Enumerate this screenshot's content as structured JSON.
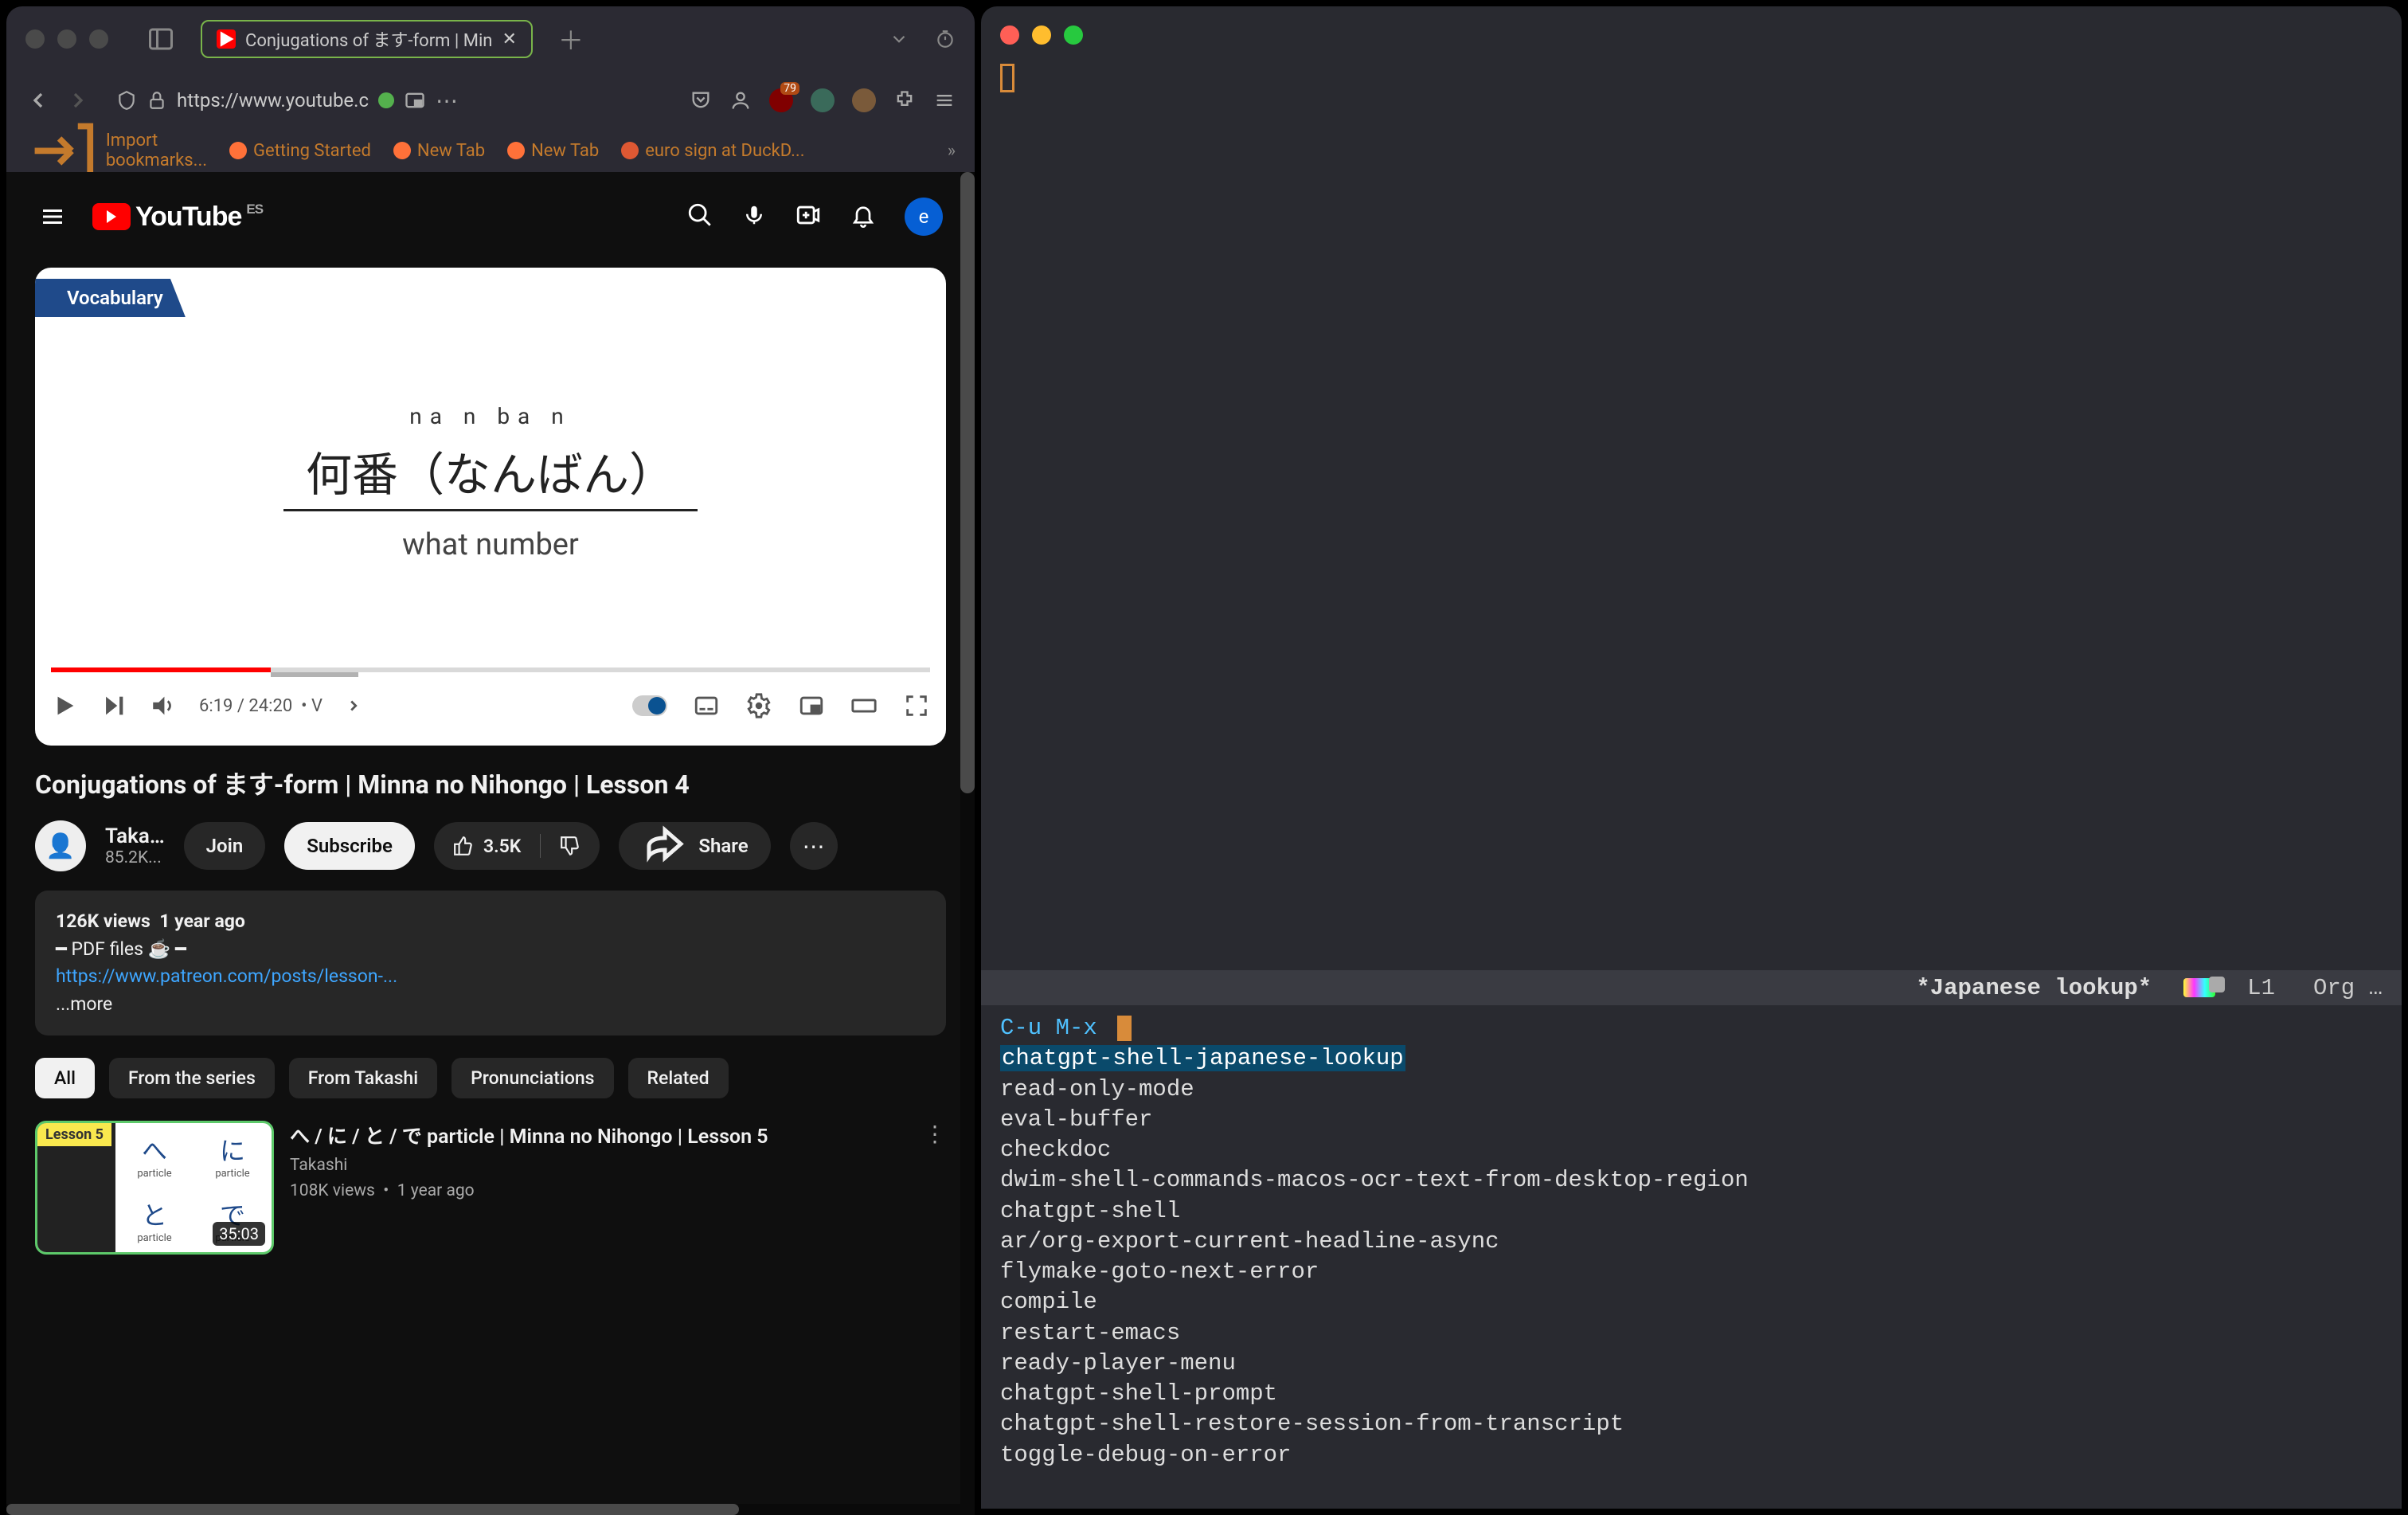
{
  "browser": {
    "tab_title": "Conjugations of ます-form | Min",
    "url": "https://www.youtube.c",
    "bookmarks": [
      {
        "icon": "import",
        "label": "Import bookmarks..."
      },
      {
        "icon": "ff",
        "label": "Getting Started"
      },
      {
        "icon": "ff",
        "label": "New Tab"
      },
      {
        "icon": "ff",
        "label": "New Tab"
      },
      {
        "icon": "ddg",
        "label": "euro sign at DuckD..."
      }
    ],
    "ext_badge": "79"
  },
  "youtube": {
    "brand": "YouTube",
    "region": "ES",
    "avatar_letter": "e",
    "video": {
      "vocab_badge": "Vocabulary",
      "furigana": "na n ba n",
      "kanji": "何番（なんばん）",
      "meaning": "what number",
      "current_time": "6:19",
      "total_time": "24:20",
      "chapter_hint": "• V",
      "title": "Conjugations of ます-form | Minna no Nihongo | Lesson 4"
    },
    "channel": {
      "name": "Taka…",
      "subs": "85.2K...",
      "join": "Join",
      "subscribe": "Subscribe",
      "likes": "3.5K",
      "share": "Share"
    },
    "desc": {
      "views": "126K views",
      "age": "1 year ago",
      "line2": "━ PDF files ☕ ━",
      "link": "https://www.patreon.com/posts/lesson-...",
      "more": "...more"
    },
    "chips": [
      "All",
      "From the series",
      "From Takashi",
      "Pronunciations",
      "Related"
    ],
    "rec": {
      "lesson_label": "Lesson 5",
      "duration": "35:03",
      "title": "へ / に / と / で particle | Minna no Nihongo | Lesson 5",
      "channel": "Takashi",
      "views": "108K views",
      "age": "1 year ago",
      "thumb_particles": [
        "へ",
        "に",
        "と",
        "で"
      ],
      "thumb_word": "particle"
    }
  },
  "emacs": {
    "modeline": {
      "buffer": "*Japanese lookup*",
      "line": "L1",
      "mode": "Org …"
    },
    "prompt": "C-u M-x ",
    "selected": "chatgpt-shell-japanese-lookup",
    "candidates": [
      "read-only-mode",
      "eval-buffer",
      "checkdoc",
      "dwim-shell-commands-macos-ocr-text-from-desktop-region",
      "chatgpt-shell",
      "ar/org-export-current-headline-async",
      "flymake-goto-next-error",
      "compile",
      "restart-emacs",
      "ready-player-menu",
      "chatgpt-shell-prompt",
      "chatgpt-shell-restore-session-from-transcript",
      "toggle-debug-on-error"
    ]
  }
}
